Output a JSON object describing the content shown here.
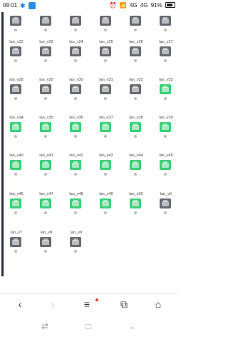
{
  "status_bar": {
    "time": "09:01",
    "network_label_1": "4G",
    "network_label_2": "4G",
    "battery": "91%"
  },
  "ports": [
    {
      "label": "",
      "state": "gray"
    },
    {
      "label": "",
      "state": "gray"
    },
    {
      "label": "",
      "state": "gray"
    },
    {
      "label": "",
      "state": "gray"
    },
    {
      "label": "",
      "state": "gray"
    },
    {
      "label": "",
      "state": "gray"
    },
    {
      "label": "lan_v22",
      "state": "gray"
    },
    {
      "label": "lan_v23",
      "state": "gray"
    },
    {
      "label": "lan_v24",
      "state": "gray"
    },
    {
      "label": "lan_v25",
      "state": "gray"
    },
    {
      "label": "lan_v26",
      "state": "gray"
    },
    {
      "label": "lan_v27",
      "state": "gray"
    },
    {
      "label": "lan_v28",
      "state": "gray"
    },
    {
      "label": "lan_v29",
      "state": "gray"
    },
    {
      "label": "lan_v30",
      "state": "gray"
    },
    {
      "label": "lan_v31",
      "state": "gray"
    },
    {
      "label": "lan_v32",
      "state": "gray"
    },
    {
      "label": "lan_v33",
      "state": "green"
    },
    {
      "label": "lan_v34",
      "state": "green"
    },
    {
      "label": "lan_v35",
      "state": "green"
    },
    {
      "label": "lan_v36",
      "state": "green"
    },
    {
      "label": "lan_v37",
      "state": "green"
    },
    {
      "label": "lan_v38",
      "state": "green"
    },
    {
      "label": "lan_v39",
      "state": "green"
    },
    {
      "label": "lan_v40",
      "state": "green"
    },
    {
      "label": "lan_v41",
      "state": "green"
    },
    {
      "label": "lan_v42",
      "state": "green"
    },
    {
      "label": "lan_v43",
      "state": "green"
    },
    {
      "label": "lan_v44",
      "state": "green"
    },
    {
      "label": "lan_v45",
      "state": "green"
    },
    {
      "label": "lan_v46",
      "state": "green"
    },
    {
      "label": "lan_v47",
      "state": "green"
    },
    {
      "label": "lan_v48",
      "state": "green"
    },
    {
      "label": "lan_v49",
      "state": "green"
    },
    {
      "label": "lan_v50",
      "state": "green"
    },
    {
      "label": "lan_v6",
      "state": "gray"
    },
    {
      "label": "lan_v7",
      "state": "gray"
    },
    {
      "label": "lan_v8",
      "state": "gray"
    },
    {
      "label": "lan_v9",
      "state": "gray"
    }
  ],
  "colors": {
    "port_gray": "#666a70",
    "port_green": "#3ccf78"
  },
  "browser_nav": {
    "back_icon": "back-arrow-icon",
    "forward_icon": "forward-arrow-icon",
    "menu_icon": "menu-icon",
    "tabs_icon": "tabs-icon",
    "home_icon": "home-icon"
  }
}
